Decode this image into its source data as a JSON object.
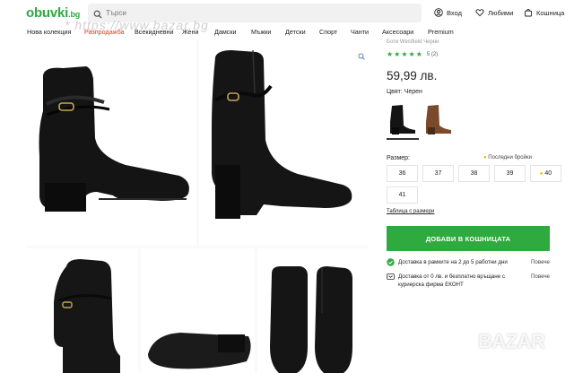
{
  "header": {
    "logo": "obuvki",
    "logo_ext": ".bg",
    "search_placeholder": "Търси",
    "login": "Вход",
    "favorites": "Любими",
    "cart": "Кошница"
  },
  "watermark": "* https://www.bazar.bg",
  "nav": [
    {
      "label": "Нова колекция"
    },
    {
      "label": "Разпродажба"
    },
    {
      "label": "Всекидневни"
    },
    {
      "label": "Жени"
    },
    {
      "label": "Дамски"
    },
    {
      "label": "Мъжки"
    },
    {
      "label": "Детски"
    },
    {
      "label": "Спорт"
    },
    {
      "label": "Чанти"
    },
    {
      "label": "Аксесоари"
    },
    {
      "label": "Premium"
    }
  ],
  "product": {
    "breadcrumb": "Боти Westfield Черни",
    "rating": 5,
    "rating_label": "5 (2)",
    "price": "59,99 лв.",
    "color_label": "Цвят: Черен",
    "size_label": "Размер:",
    "last_items": "Последни бройки",
    "sizes": [
      {
        "label": "36",
        "last": false
      },
      {
        "label": "37",
        "last": false
      },
      {
        "label": "38",
        "last": false
      },
      {
        "label": "39",
        "last": false
      },
      {
        "label": "40",
        "last": true
      },
      {
        "label": "41",
        "last": false
      }
    ],
    "size_table": "Таблица с размери",
    "add_to_cart": "ДОБАВИ В КОШНИЦАТА",
    "delivery": [
      {
        "text": "Доставка в рамките на 2 до 5 работни дни",
        "more": "Повече"
      },
      {
        "text": "Доставка от 0 лв. и безплатно връщане с куриерска фирма ЕКОНТ",
        "more": "Повече"
      }
    ]
  },
  "footer_watermark": "BAZAR",
  "colors": {
    "brand": "#2eaa3e",
    "sale": "#e0341f",
    "star": "#2eaa3e",
    "last_item_dot": "#f0b400"
  }
}
